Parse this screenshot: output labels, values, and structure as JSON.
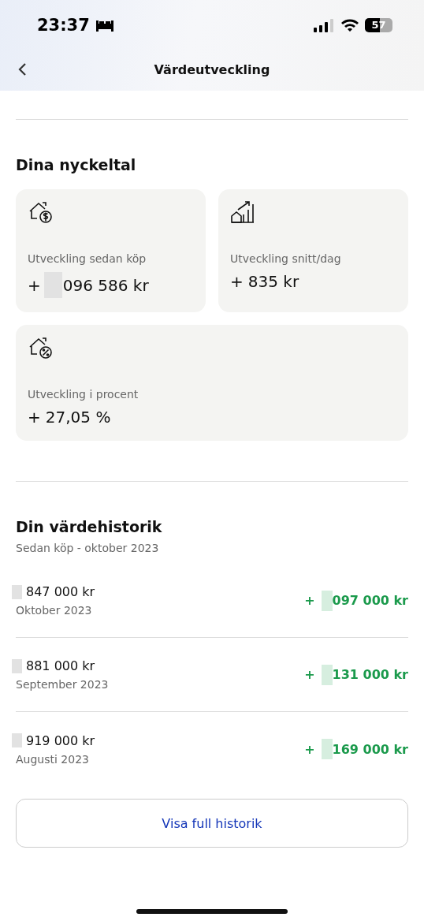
{
  "status_bar": {
    "time": "23:37",
    "battery": "57"
  },
  "nav": {
    "title": "Värdeutveckling"
  },
  "key_figures": {
    "heading": "Dina nyckeltal",
    "cards": [
      {
        "kind": "redacted",
        "label": "Utveckling sedan köp",
        "sign": "+",
        "value": "096 586 kr"
      },
      {
        "kind": "plain",
        "label": "Utveckling snitt/dag",
        "sign": "+",
        "value": "835 kr"
      },
      {
        "kind": "plain",
        "label": "Utveckling i procent",
        "sign": "+",
        "value": "27,05 %"
      }
    ]
  },
  "history": {
    "heading": "Din värdehistorik",
    "subtitle": "Sedan köp - oktober 2023",
    "rows": [
      {
        "value": "847 000 kr",
        "month": "Oktober 2023",
        "sign": "+",
        "change": "097 000 kr"
      },
      {
        "value": "881 000 kr",
        "month": "September 2023",
        "sign": "+",
        "change": "131 000 kr"
      },
      {
        "value": "919 000 kr",
        "month": "Augusti 2023",
        "sign": "+",
        "change": "169 000 kr"
      }
    ],
    "button": "Visa full historik"
  }
}
